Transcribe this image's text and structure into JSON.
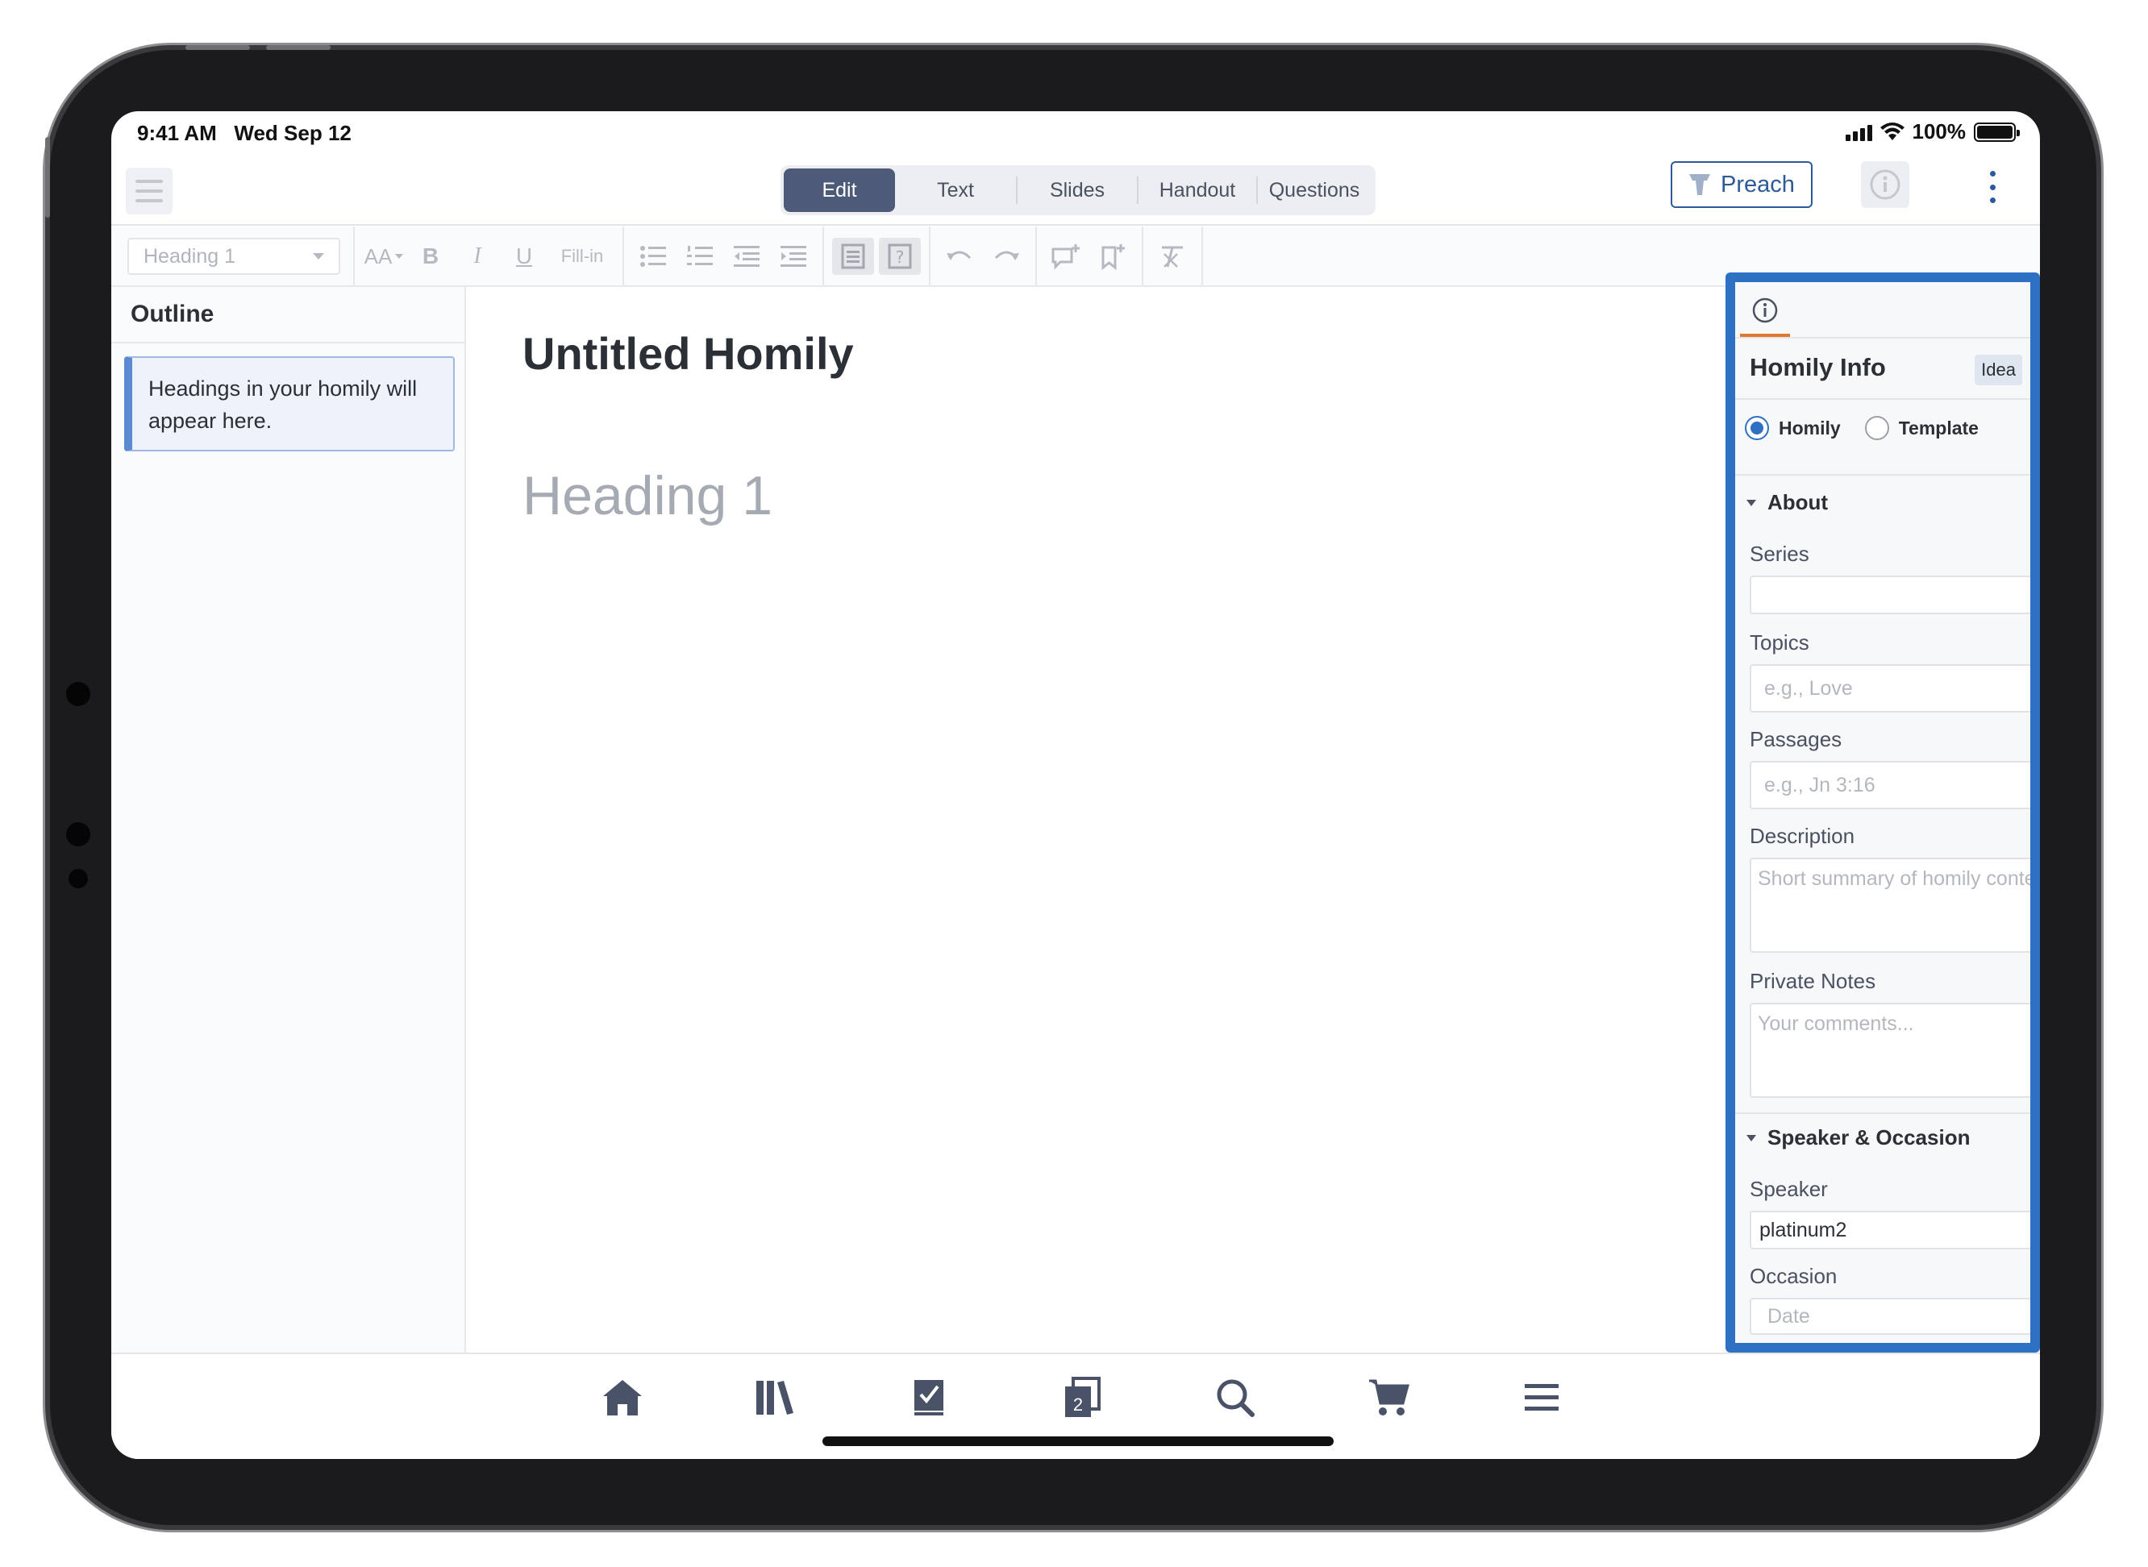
{
  "status_bar": {
    "time": "9:41 AM",
    "date": "Wed Sep 12",
    "battery": "100%"
  },
  "top_bar": {
    "tabs": [
      {
        "label": "Edit",
        "active": true
      },
      {
        "label": "Text",
        "active": false
      },
      {
        "label": "Slides",
        "active": false
      },
      {
        "label": "Handout",
        "active": false
      },
      {
        "label": "Questions",
        "active": false
      }
    ],
    "preach_label": "Preach"
  },
  "toolbar": {
    "style_value": "Heading 1",
    "bold": "B",
    "italic": "I",
    "underline": "U",
    "font_size": "AA",
    "fill_in": "Fill-in"
  },
  "outline": {
    "title": "Outline",
    "hint": "Headings in your homily will appear here."
  },
  "editor": {
    "title": "Untitled Homily",
    "placeholder_heading": "Heading 1"
  },
  "info_panel": {
    "title": "Homily Info",
    "badge": "Idea",
    "radio_options": [
      {
        "label": "Homily",
        "selected": true
      },
      {
        "label": "Template",
        "selected": false
      }
    ],
    "about_section": "About",
    "series_label": "Series",
    "series_value": "",
    "topics_label": "Topics",
    "topics_placeholder": "e.g., Love",
    "passages_label": "Passages",
    "passages_placeholder": "e.g., Jn 3:16",
    "description_label": "Description",
    "description_placeholder": "Short summary of homily content...",
    "private_notes_label": "Private Notes",
    "private_notes_placeholder": "Your comments...",
    "speaker_section": "Speaker & Occasion",
    "speaker_label": "Speaker",
    "speaker_value": "platinum2",
    "occasion_label": "Occasion",
    "date_placeholder": "Date"
  },
  "tab_bar": {
    "icons": [
      "home-icon",
      "library-icon",
      "tasks-icon",
      "documents-icon",
      "search-icon",
      "cart-icon",
      "menu-icon"
    ],
    "documents_badge": "2"
  },
  "colors": {
    "accent": "#2d70c4",
    "segment_active": "#4d5a78",
    "preach": "#2d5a9a",
    "tab_underline": "#e07a2e",
    "tab_icon": "#4a5268"
  }
}
